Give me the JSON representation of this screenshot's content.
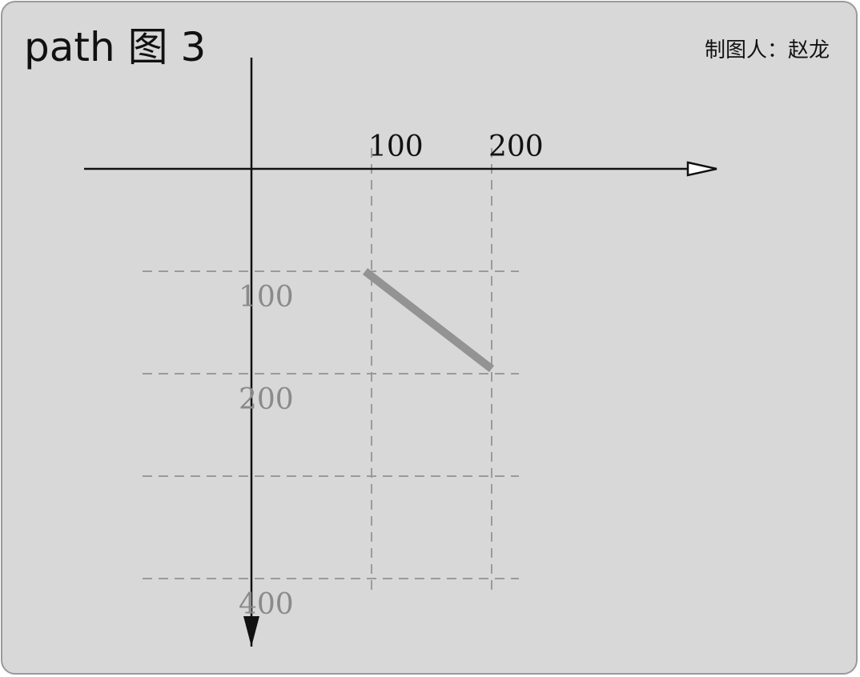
{
  "title": "path 图 3",
  "author": "制图人：赵龙",
  "x_axis": {
    "ticks": [
      {
        "value": 100,
        "label": "100"
      },
      {
        "value": 200,
        "label": "200"
      }
    ]
  },
  "y_axis": {
    "ticks": [
      {
        "value": 100,
        "label": "100"
      },
      {
        "value": 200,
        "label": "200"
      },
      {
        "value": 400,
        "label": "400"
      }
    ]
  },
  "grid": {
    "x_values": [
      100,
      200
    ],
    "y_values": [
      100,
      200,
      300,
      400
    ]
  },
  "path": {
    "from": [
      100,
      100
    ],
    "to": [
      200,
      200
    ]
  },
  "colors": {
    "background": "#d8d8d8",
    "border": "#9a9a9a",
    "axis": "#111111",
    "grid": "#9a9a9a",
    "path": "#939393",
    "y_label": "#8a8a8a"
  }
}
